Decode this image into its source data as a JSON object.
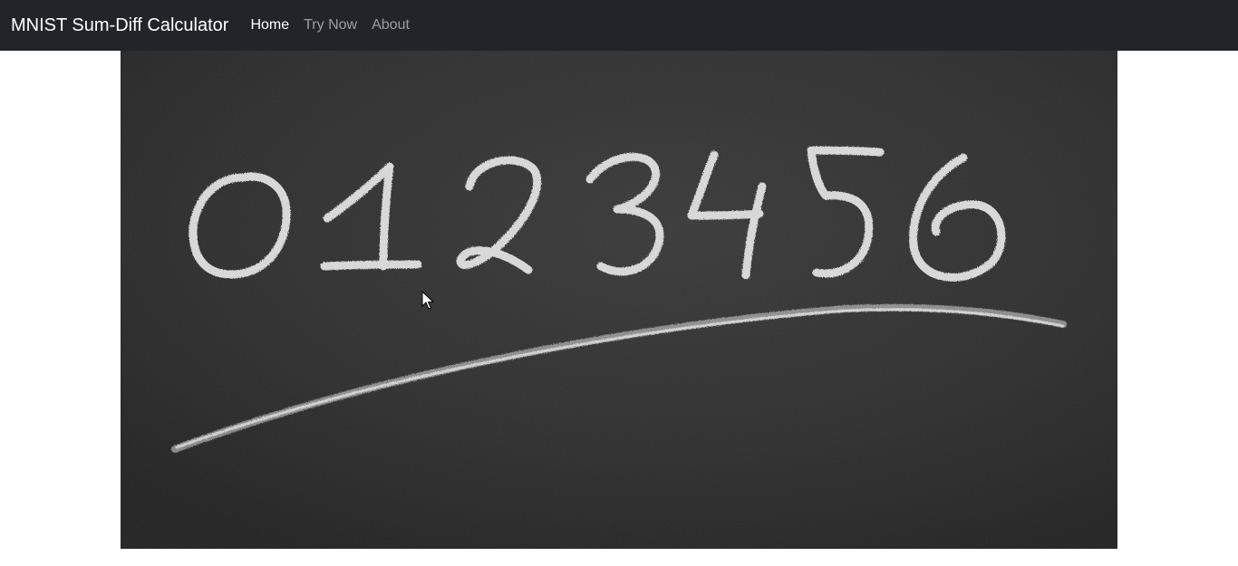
{
  "navbar": {
    "brand": "MNIST Sum-Diff Calculator",
    "links": [
      {
        "label": "Home",
        "active": true
      },
      {
        "label": "Try Now",
        "active": false
      },
      {
        "label": "About",
        "active": false
      }
    ]
  },
  "hero": {
    "digits": "0123456"
  },
  "colors": {
    "navbar_bg": "#212529",
    "chalkboard": "#2e2e2e",
    "chalk": "#e8e8e8"
  }
}
